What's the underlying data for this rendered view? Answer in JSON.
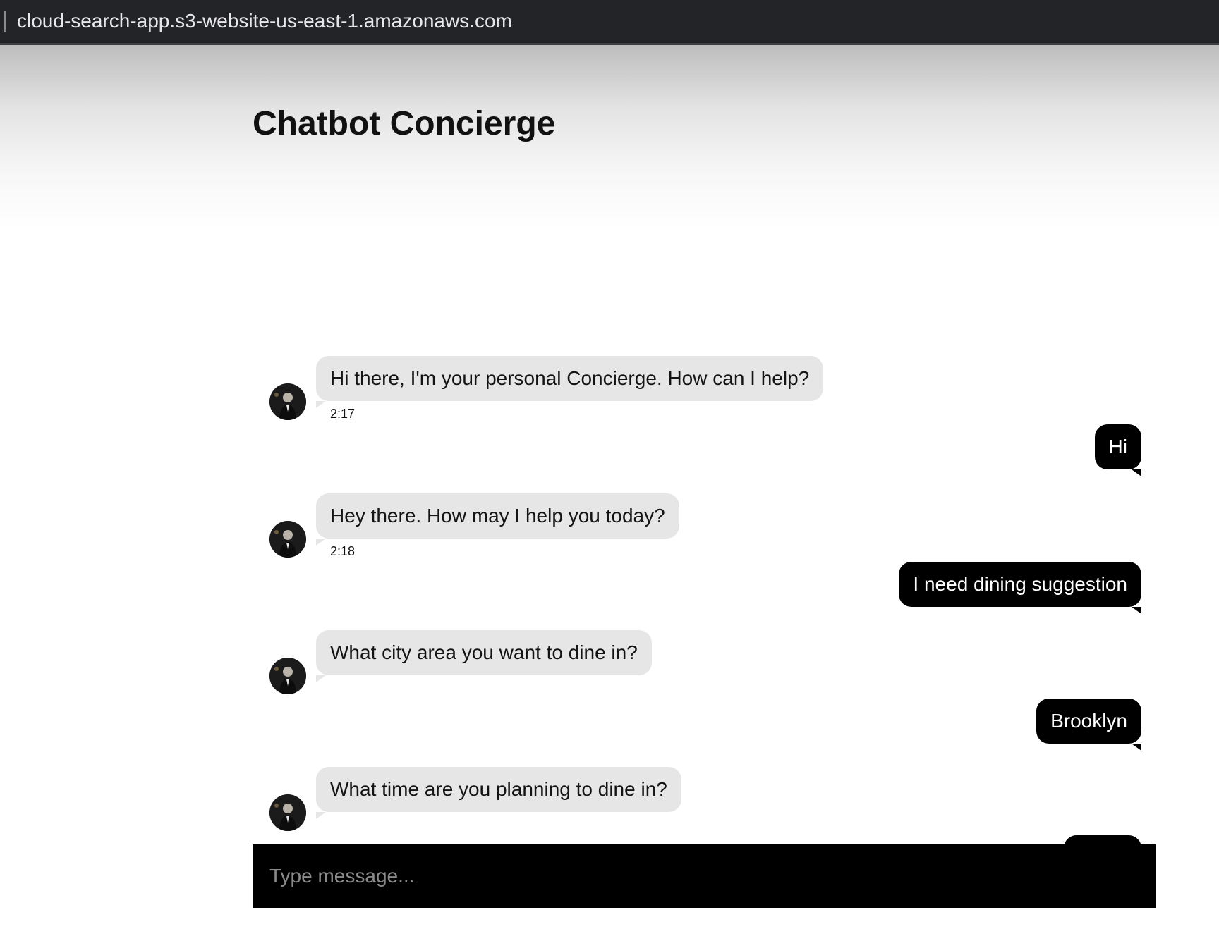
{
  "browser": {
    "url": "cloud-search-app.s3-website-us-east-1.amazonaws.com"
  },
  "page": {
    "title": "Chatbot Concierge"
  },
  "messages": [
    {
      "sender": "bot",
      "text": "Hi there, I'm your personal Concierge. How can I help?",
      "time": "2:17"
    },
    {
      "sender": "user",
      "text": "Hi"
    },
    {
      "sender": "bot",
      "text": "Hey there. How may I help you today?",
      "time": "2:18"
    },
    {
      "sender": "user",
      "text": "I need dining suggestion"
    },
    {
      "sender": "bot",
      "text": "What city area you want to dine in?"
    },
    {
      "sender": "user",
      "text": "Brooklyn"
    },
    {
      "sender": "bot",
      "text": "What time are you planning to dine in?"
    },
    {
      "sender": "user",
      "text": ""
    }
  ],
  "composer": {
    "placeholder": "Type message..."
  },
  "colors": {
    "bot_bubble": "#e6e6e6",
    "user_bubble": "#000000",
    "browser_bar": "#232427"
  }
}
